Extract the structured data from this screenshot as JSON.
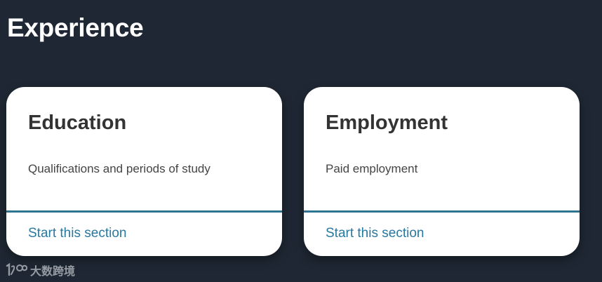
{
  "page": {
    "title": "Experience"
  },
  "cards": [
    {
      "title": "Education",
      "description": "Qualifications and periods of study",
      "link_label": "Start this section"
    },
    {
      "title": "Employment",
      "description": "Paid employment",
      "link_label": "Start this section"
    }
  ],
  "watermark": {
    "text": "大数跨境",
    "logo": "1to-logo-icon"
  },
  "colors": {
    "background": "#1e2733",
    "card": "#ffffff",
    "heading": "#333333",
    "divider": "#2e7390",
    "link": "#2878a0"
  }
}
